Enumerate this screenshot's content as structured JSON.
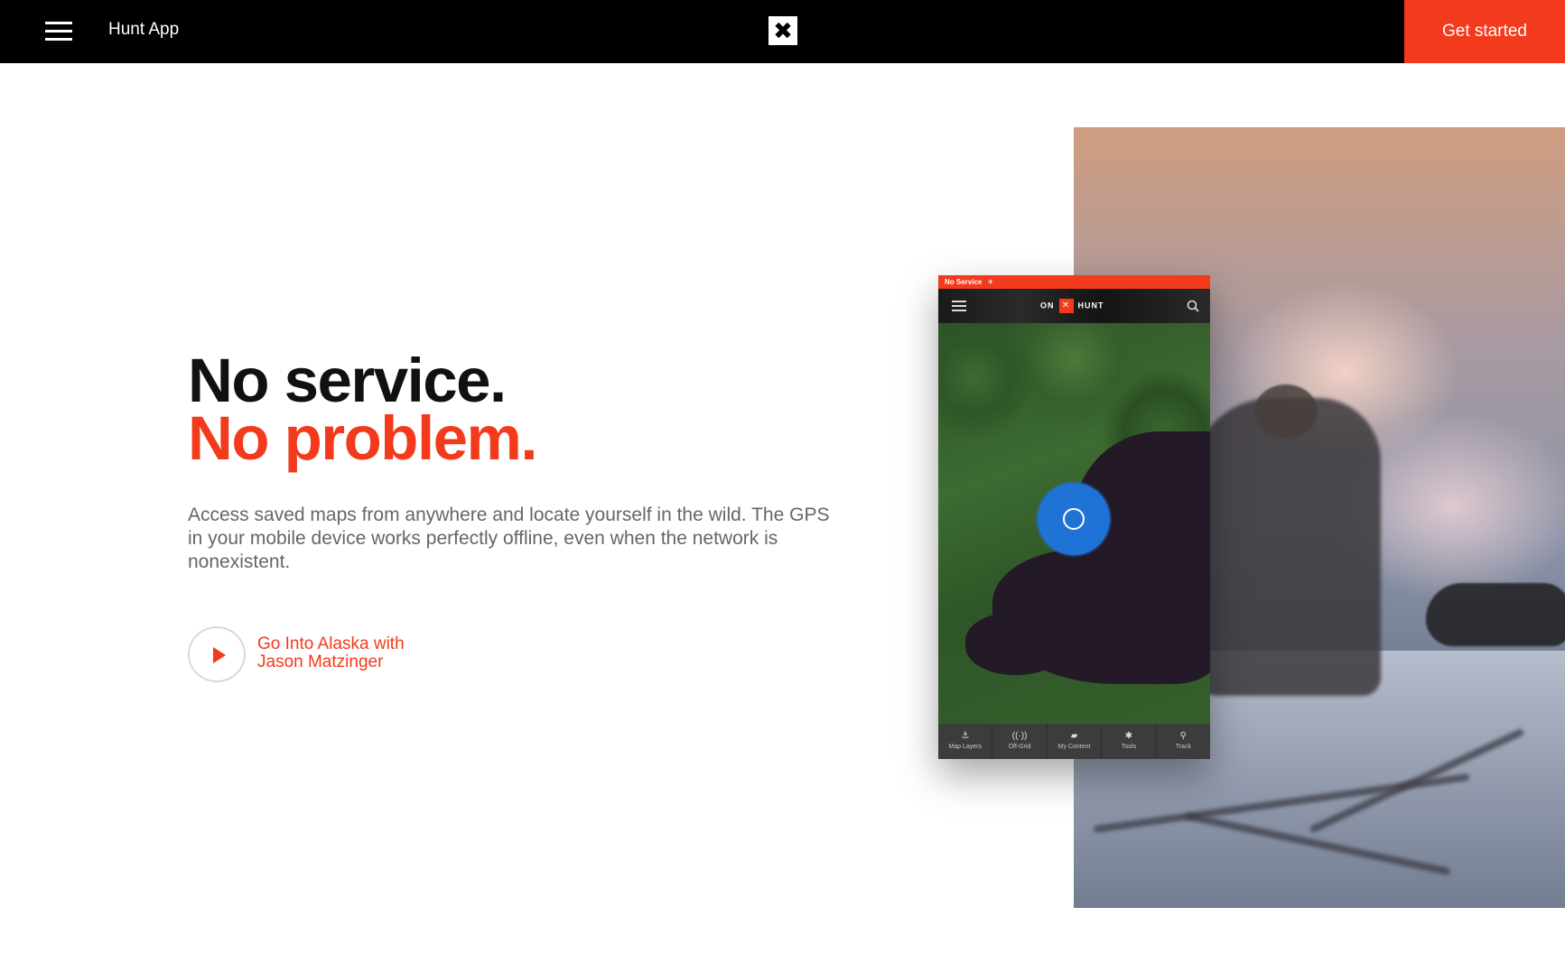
{
  "nav": {
    "title": "Hunt App",
    "logo_glyph": "✖",
    "cta_label": "Get started"
  },
  "hero": {
    "headline_line1": "No service.",
    "headline_line2": "No problem.",
    "body": "Access saved maps from anywhere and locate yourself in the wild. The GPS in your mobile device works perfectly offline, even when the network is nonexistent.",
    "video_link": {
      "line1": "Go Into Alaska with",
      "line2": "Jason Matzinger",
      "icon": "play-icon"
    }
  },
  "phone": {
    "status_text": "No Service",
    "brand_left": "ON",
    "brand_x": "✕",
    "brand_right": "HUNT",
    "tabs": [
      {
        "label": "Map Layers",
        "icon": "map-layers-icon",
        "glyph": "⚓"
      },
      {
        "label": "Off-Grid",
        "icon": "off-grid-icon",
        "glyph": "((·))"
      },
      {
        "label": "My Content",
        "icon": "folder-icon",
        "glyph": "▰"
      },
      {
        "label": "Tools",
        "icon": "tools-icon",
        "glyph": "✱"
      },
      {
        "label": "Track",
        "icon": "track-icon",
        "glyph": "⚲"
      }
    ]
  },
  "colors": {
    "accent": "#f23a1c",
    "nav_bg": "#000000",
    "body_text": "#666666",
    "gps_blue": "#1f73d6"
  }
}
